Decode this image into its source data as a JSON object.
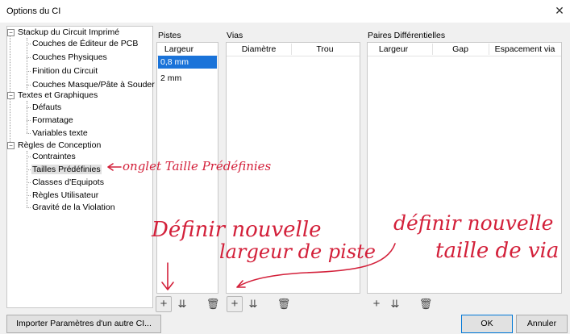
{
  "window": {
    "title": "Options du CI"
  },
  "tree": {
    "groups": [
      {
        "label": "Stackup du Circuit Imprimé",
        "children": [
          "Couches de Éditeur de PCB",
          "Couches Physiques",
          "Finition du Circuit",
          "Couches Masque/Pâte à Souder"
        ]
      },
      {
        "label": "Textes et Graphiques",
        "children": [
          "Défauts",
          "Formatage",
          "Variables texte"
        ]
      },
      {
        "label": "Règles de Conception",
        "children": [
          "Contraintes",
          "Tailles Prédéfinies",
          "Classes d'Equipots",
          "Règles Utilisateur",
          "Gravité de la Violation"
        ]
      }
    ],
    "selected": "Tailles Prédéfinies"
  },
  "pistes": {
    "title": "Pistes",
    "column": "Largeur",
    "rows": [
      "0,8 mm",
      "2 mm"
    ],
    "selected_index": 0
  },
  "vias": {
    "title": "Vias",
    "columns": [
      "Diamètre",
      "Trou"
    ]
  },
  "paires": {
    "title": "Paires Différentielles",
    "columns": [
      "Largeur",
      "Gap",
      "Espacement via"
    ]
  },
  "buttons": {
    "import": "Importer Paramètres d'un autre CI...",
    "ok": "OK",
    "cancel": "Annuler"
  },
  "annotations": {
    "tab_note": "onglet Taille Prédéfinies",
    "track_note_line1": "Définir nouvelle",
    "track_note_line2": "largeur de piste",
    "via_note_line1": "définir nouvelle",
    "via_note_line2": "taille de via",
    "color": "#d3203a"
  },
  "icons": {
    "add": "plus-icon",
    "import_row": "import-icon",
    "delete": "trash-icon",
    "close": "close-icon"
  }
}
